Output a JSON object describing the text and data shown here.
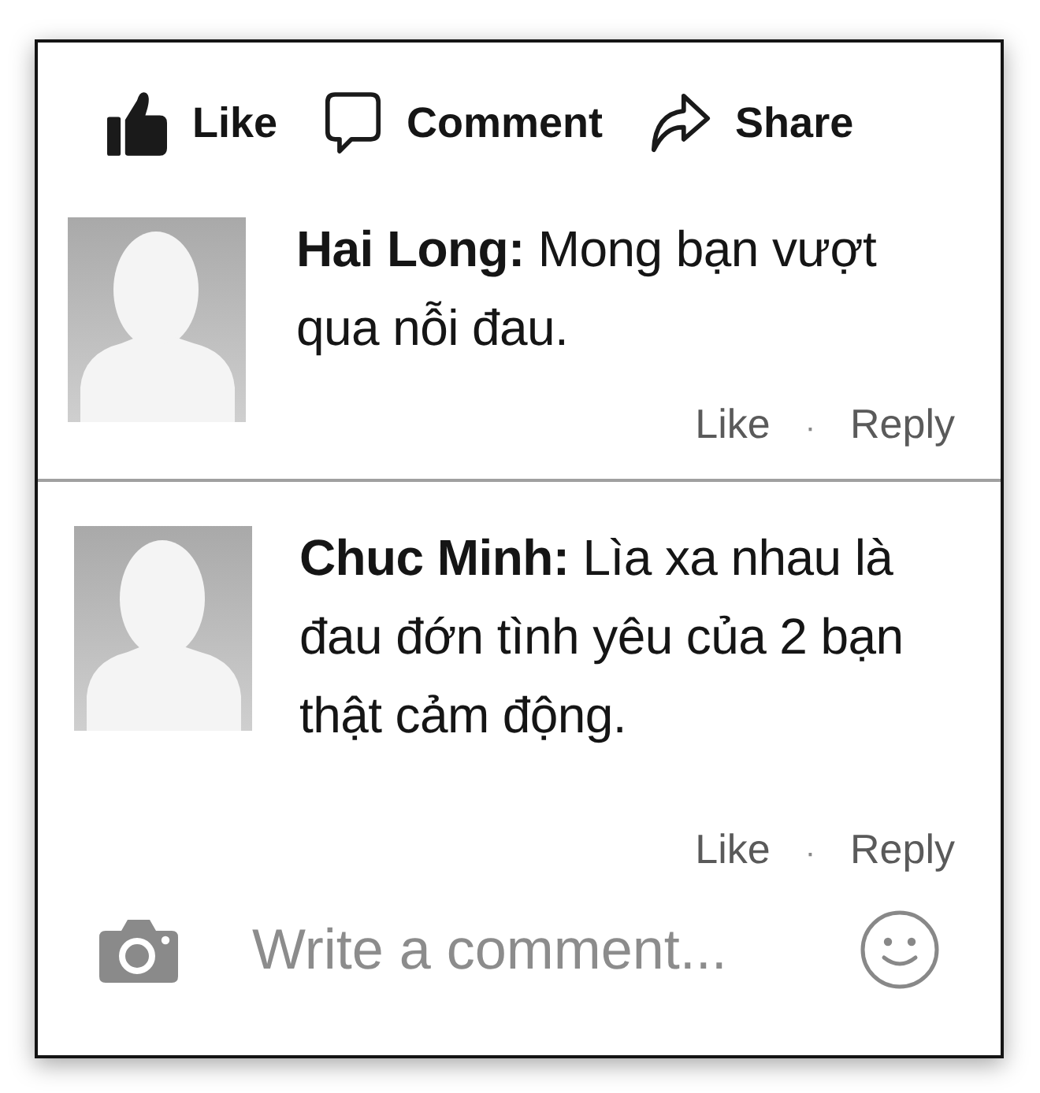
{
  "actions": [
    {
      "kind": "like",
      "label": "Like"
    },
    {
      "kind": "comment",
      "label": "Comment"
    },
    {
      "kind": "share",
      "label": "Share"
    }
  ],
  "comments": [
    {
      "text": "**Hai Long:** Mong bạn vượt qua nỗi đau.",
      "like_label": "Like",
      "separator": "·",
      "reply_label": "Reply"
    },
    {
      "text": "**Chuc Minh:** Lìa xa nhau là đau đớn tình yêu của 2 bạn thật cảm động.",
      "like_label": "Like",
      "separator": "·",
      "reply_label": "Reply"
    }
  ],
  "composer": {
    "placeholder": "Write a comment..."
  }
}
